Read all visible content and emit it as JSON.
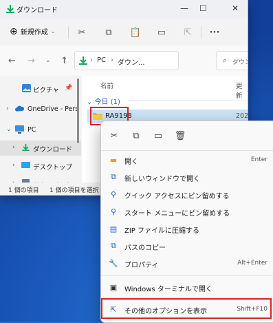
{
  "window": {
    "title": "ダウンロード",
    "close_glyph": "✕"
  },
  "command_bar": {
    "new_label": "新規作成"
  },
  "address": {
    "crumbs": [
      "PC",
      "ダウン..."
    ],
    "search_placeholder": "ダウンロ"
  },
  "nav_pane": {
    "items": [
      {
        "label": "ピクチャ"
      },
      {
        "label": "OneDrive - Pers"
      },
      {
        "label": "PC"
      },
      {
        "label": "ダウンロード"
      },
      {
        "label": "デスクトップ"
      },
      {
        "label": "ドキュメント"
      }
    ]
  },
  "content": {
    "col_name": "名前",
    "col_updated": "更新",
    "group": "今日 (1)",
    "file": {
      "name": "RA9198",
      "date": "202"
    }
  },
  "status": {
    "count": "1 個の項目",
    "selected": "1 個の項目を選択"
  },
  "context_menu": {
    "items": [
      {
        "label": "開く",
        "shortcut": "Enter"
      },
      {
        "label": "新しいウィンドウで開く",
        "shortcut": ""
      },
      {
        "label": "クイック アクセスにピン留めする",
        "shortcut": ""
      },
      {
        "label": "スタート メニューにピン留めする",
        "shortcut": ""
      },
      {
        "label": "ZIP ファイルに圧縮する",
        "shortcut": ""
      },
      {
        "label": "パスのコピー",
        "shortcut": ""
      },
      {
        "label": "プロパティ",
        "shortcut": "Alt+Enter"
      },
      {
        "label": "Windows ターミナルで開く",
        "shortcut": ""
      },
      {
        "label": "その他のオプションを表示",
        "shortcut": "Shift+F10"
      }
    ]
  },
  "colors": {
    "accent": "#2463c8",
    "highlight_border": "#dd2222",
    "selection": "#cce4f7"
  }
}
